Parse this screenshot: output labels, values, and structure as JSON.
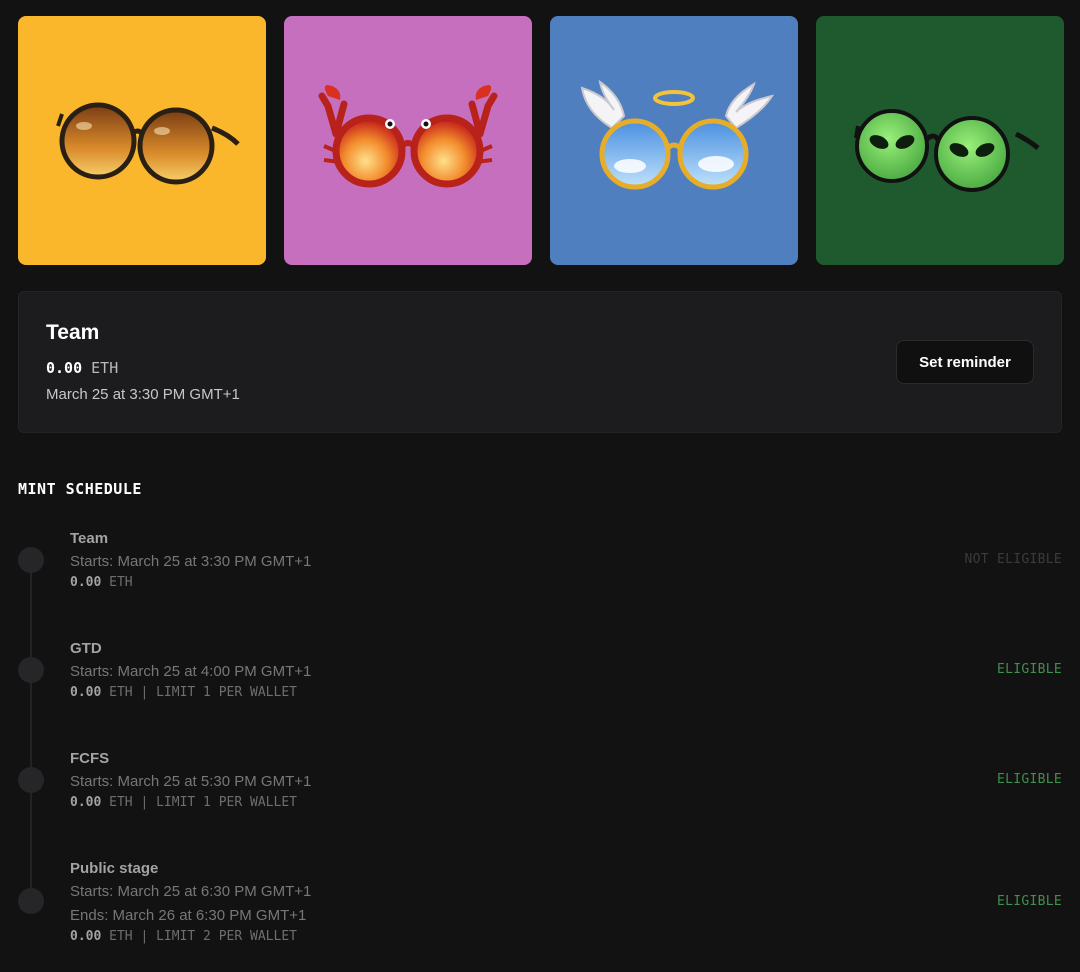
{
  "gallery": [
    {
      "name": "Classic Amber Shades",
      "bg": "#fbb72c"
    },
    {
      "name": "Crab Shades",
      "bg": "#c76fbf"
    },
    {
      "name": "Angel Shades",
      "bg": "#4f7fbf"
    },
    {
      "name": "Alien Shades",
      "bg": "#1e5a2d"
    }
  ],
  "current_phase": {
    "name": "Team",
    "price_amount": "0.00",
    "price_currency": "ETH",
    "date": "March 25 at 3:30 PM GMT+1",
    "reminder_label": "Set reminder"
  },
  "schedule": {
    "title": "MINT SCHEDULE",
    "stages": [
      {
        "name": "Team",
        "starts": "Starts: March 25 at 3:30 PM GMT+1",
        "ends": "",
        "price_amount": "0.00",
        "price_rest": "ETH",
        "status": "NOT ELIGIBLE"
      },
      {
        "name": "GTD",
        "starts": "Starts: March 25 at 4:00 PM GMT+1",
        "ends": "",
        "price_amount": "0.00",
        "price_rest": "ETH | LIMIT 1 PER WALLET",
        "status": "ELIGIBLE"
      },
      {
        "name": "FCFS",
        "starts": "Starts: March 25 at 5:30 PM GMT+1",
        "ends": "",
        "price_amount": "0.00",
        "price_rest": "ETH | LIMIT 1 PER WALLET",
        "status": "ELIGIBLE"
      },
      {
        "name": "Public stage",
        "starts": "Starts: March 25 at 6:30 PM GMT+1",
        "ends": "Ends: March 26 at 6:30 PM GMT+1",
        "price_amount": "0.00",
        "price_rest": "ETH | LIMIT 2 PER WALLET",
        "status": "ELIGIBLE"
      }
    ]
  },
  "colors": {
    "background": "#121213",
    "card": "#1c1c1e",
    "eligible": "#3f8f4e",
    "not_eligible": "#3b3b3e"
  }
}
